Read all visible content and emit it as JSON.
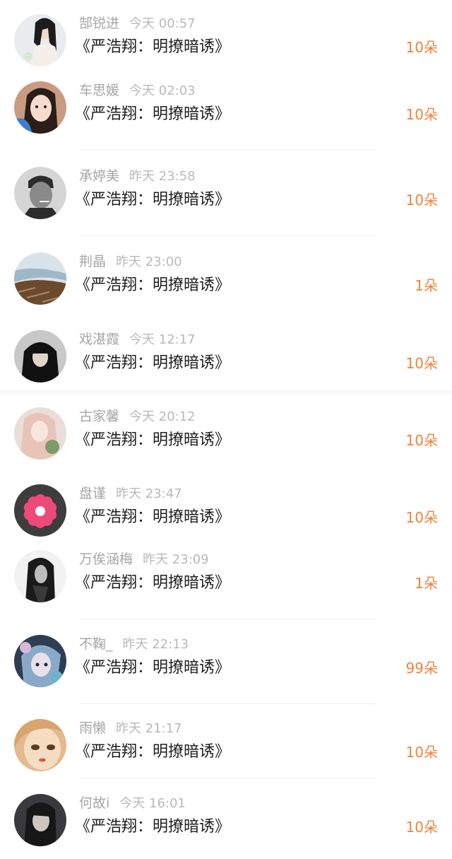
{
  "rows": [
    {
      "name": "郜锐进",
      "time": "今天 00:57",
      "title": "《严浩翔：明撩暗诱》",
      "count": "10朵",
      "avatar": "girl-white-dress-avatar",
      "colors": [
        "#e9ecef",
        "#1c1c1c",
        "#f4efe8"
      ]
    },
    {
      "name": "车思媛",
      "time": "今天 02:03",
      "title": "《严浩翔：明撩暗诱》",
      "count": "10朵",
      "avatar": "girl-selfie-avatar",
      "colors": [
        "#d9a98f",
        "#2b1d17",
        "#3a7fd0"
      ]
    },
    {
      "name": "承婷美",
      "time": "昨天 23:58",
      "title": "《严浩翔：明撩暗诱》",
      "count": "10朵",
      "avatar": "man-smoking-bw-avatar",
      "colors": [
        "#d5d5d5",
        "#2c2c2c",
        "#8a8a8a"
      ]
    },
    {
      "name": "荆晶",
      "time": "昨天 23:00",
      "title": "《严浩翔：明撩暗诱》",
      "count": "1朵",
      "avatar": "seascape-avatar",
      "colors": [
        "#9fb8c8",
        "#6b4a2e",
        "#d8e3ea"
      ]
    },
    {
      "name": "戏湛霞",
      "time": "今天 12:17",
      "title": "《严浩翔：明撩暗诱》",
      "count": "10朵",
      "avatar": "boy-black-hoodie-avatar",
      "colors": [
        "#c8c8c8",
        "#111111",
        "#e1d4c8"
      ]
    },
    {
      "name": "古家馨",
      "time": "今天 20:12",
      "title": "《严浩翔：明撩暗诱》",
      "count": "10朵",
      "avatar": "anime-girl-pink-hair-avatar",
      "colors": [
        "#eadfd8",
        "#e8c4b8",
        "#7e9b6a"
      ]
    },
    {
      "name": "盘谨",
      "time": "昨天 23:47",
      "title": "《严浩翔：明撩暗诱》",
      "count": "10朵",
      "avatar": "pink-flower-avatar",
      "colors": [
        "#3d3d3d",
        "#ee4a78",
        "#ffffff"
      ]
    },
    {
      "name": "万俟涵梅",
      "time": "昨天 23:09",
      "title": "《严浩翔：明撩暗诱》",
      "count": "1朵",
      "avatar": "girl-dark-hair-bw-avatar",
      "colors": [
        "#f2f2f2",
        "#1a1a1a",
        "#bdbdbd"
      ]
    },
    {
      "name": "不鞠_",
      "time": "昨天 22:13",
      "title": "《严浩翔：明撩暗诱》",
      "count": "99朵",
      "avatar": "anime-boy-flowers-avatar",
      "colors": [
        "#2d3e52",
        "#8aa9c8",
        "#d7b8d9"
      ]
    },
    {
      "name": "雨懒",
      "time": "昨天 21:17",
      "title": "《严浩翔：明撩暗诱》",
      "count": "10朵",
      "avatar": "doll-face-avatar",
      "colors": [
        "#e4b98d",
        "#f6dcc0",
        "#5b3b26"
      ]
    },
    {
      "name": "何故i",
      "time": "今天 16:01",
      "title": "《严浩翔：明撩暗诱》",
      "count": "10朵",
      "avatar": "boy-dark-portrait-avatar",
      "colors": [
        "#3a3a3e",
        "#cfc7bf",
        "#171717"
      ]
    }
  ],
  "accent_color": "#f0823c"
}
